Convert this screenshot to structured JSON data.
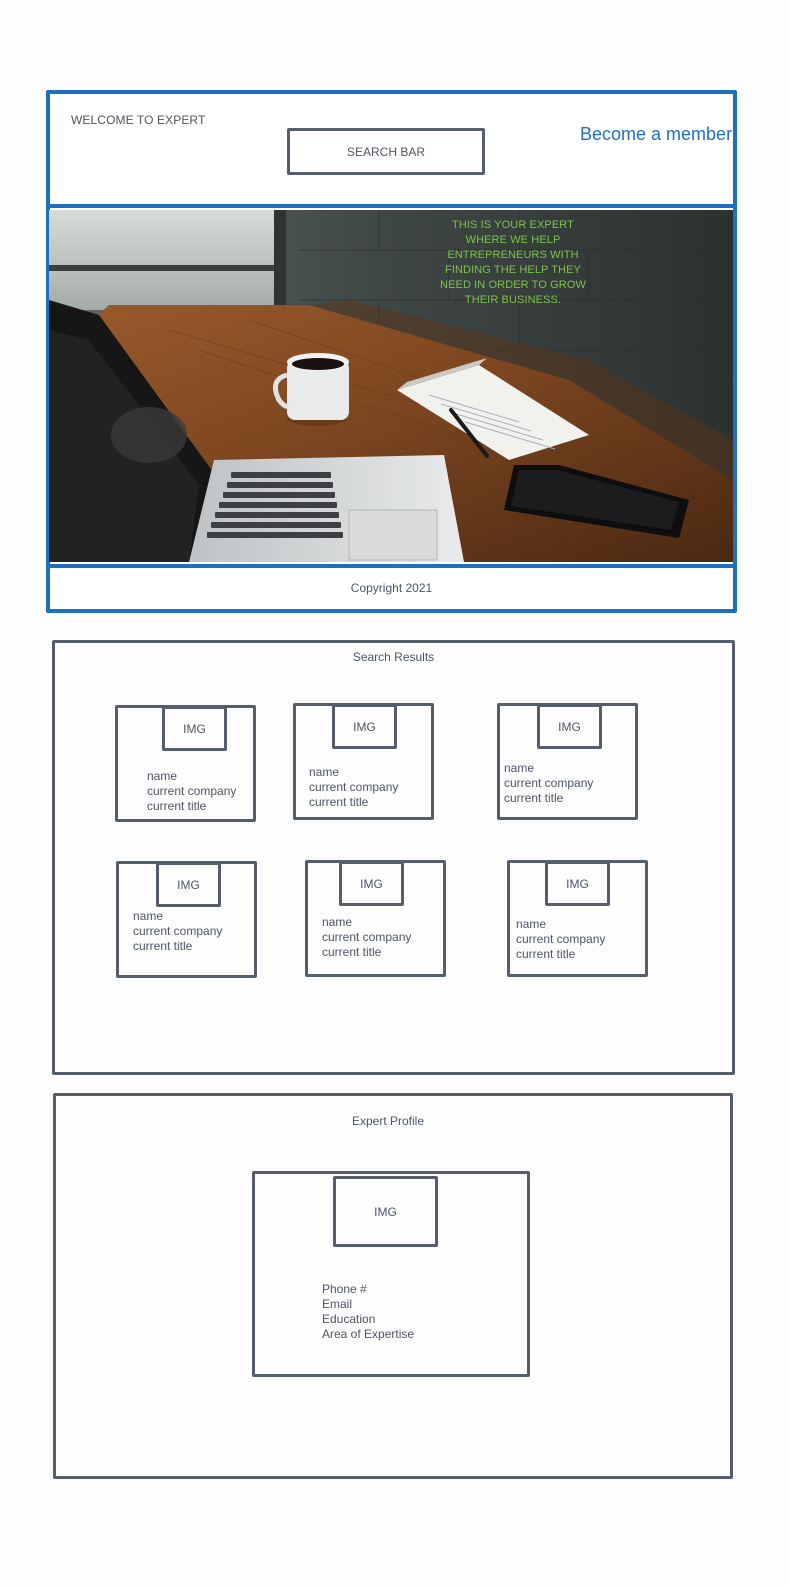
{
  "header": {
    "welcome_text": "WELCOME TO EXPERT",
    "search_bar_label": "SEARCH BAR",
    "become_member_label": "Become a member"
  },
  "hero": {
    "tagline": "THIS IS YOUR EXPERT WHERE WE HELP ENTREPRENEURS WITH FINDING THE HELP THEY NEED IN ORDER TO GROW THEIR BUSINESS.",
    "tagline_color": "#7ec24a"
  },
  "footer": {
    "copyright": "Copyright 2021"
  },
  "search_results": {
    "title": "Search Results",
    "cards": [
      {
        "img_label": "IMG",
        "name": "name",
        "company": "current company",
        "title": "current title"
      },
      {
        "img_label": "IMG",
        "name": "name",
        "company": "current company",
        "title": "current title"
      },
      {
        "img_label": "IMG",
        "name": "name",
        "company": "current company",
        "title": "current title"
      },
      {
        "img_label": "IMG",
        "name": "name",
        "company": "current company",
        "title": "current title"
      },
      {
        "img_label": "IMG",
        "name": "name",
        "company": "current company",
        "title": "current title"
      },
      {
        "img_label": "IMG",
        "name": "name",
        "company": "current company",
        "title": "current title"
      }
    ]
  },
  "expert_profile": {
    "title": "Expert Profile",
    "img_label": "IMG",
    "fields": [
      "Phone #",
      "Email",
      "Education",
      "Area of Expertise"
    ]
  },
  "colors": {
    "accent": "#1f6fc1",
    "sketch_stroke": "#565e6e",
    "text": "#4d5565"
  }
}
